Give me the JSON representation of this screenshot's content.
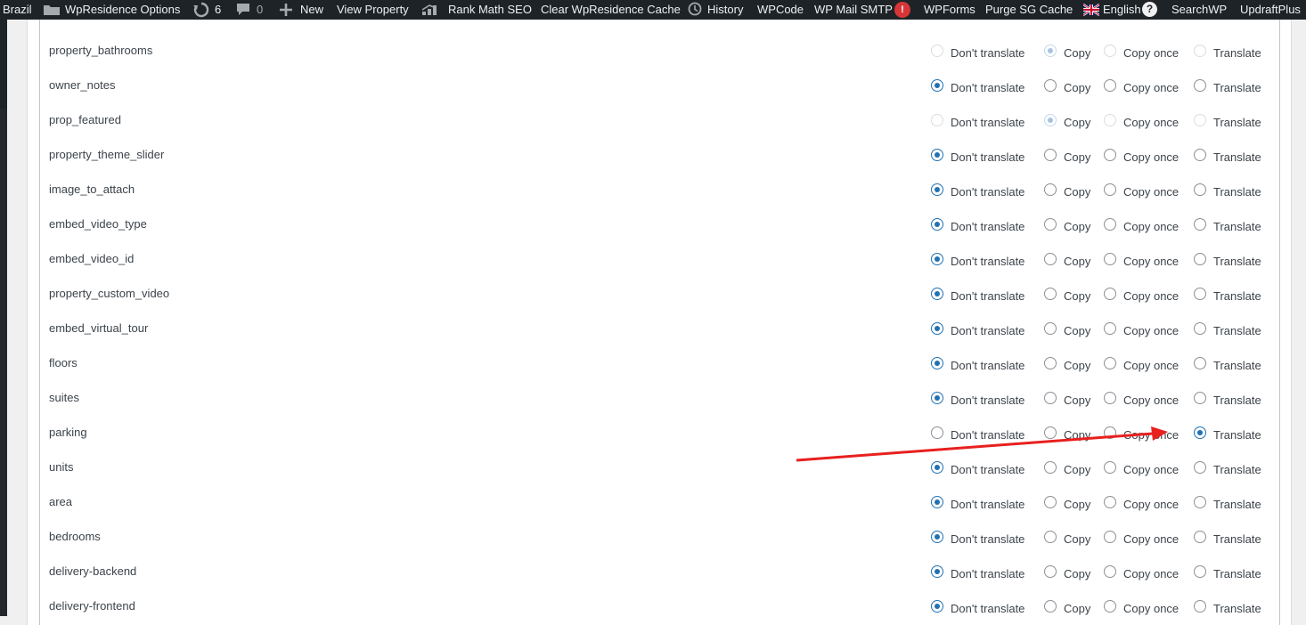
{
  "adminbar": {
    "site_name": "Brazil",
    "theme_options": "WpResidence Options",
    "updates_count": "6",
    "comments_count": "0",
    "new_label": "New",
    "view_property": "View Property",
    "rank_math": "Rank Math SEO",
    "clear_cache": "Clear WpResidence Cache",
    "history": "History",
    "wpcode": "WPCode",
    "wp_mail_smtp": "WP Mail SMTP",
    "smtp_alert": "!",
    "wpforms": "WPForms",
    "purge_cache": "Purge SG Cache",
    "language": "English",
    "help": "?",
    "searchwp": "SearchWP",
    "updraftplus": "UpdraftPlus"
  },
  "options": [
    "Don't translate",
    "Copy",
    "Copy once",
    "Translate"
  ],
  "fields": [
    {
      "name": "property_bathrooms",
      "selected": 1,
      "disabled": true
    },
    {
      "name": "owner_notes",
      "selected": 0,
      "disabled": false
    },
    {
      "name": "prop_featured",
      "selected": 1,
      "disabled": true
    },
    {
      "name": "property_theme_slider",
      "selected": 0,
      "disabled": false
    },
    {
      "name": "image_to_attach",
      "selected": 0,
      "disabled": false
    },
    {
      "name": "embed_video_type",
      "selected": 0,
      "disabled": false
    },
    {
      "name": "embed_video_id",
      "selected": 0,
      "disabled": false
    },
    {
      "name": "property_custom_video",
      "selected": 0,
      "disabled": false
    },
    {
      "name": "embed_virtual_tour",
      "selected": 0,
      "disabled": false
    },
    {
      "name": "floors",
      "selected": 0,
      "disabled": false
    },
    {
      "name": "suites",
      "selected": 0,
      "disabled": false
    },
    {
      "name": "parking",
      "selected": 3,
      "disabled": false
    },
    {
      "name": "units",
      "selected": 0,
      "disabled": false
    },
    {
      "name": "area",
      "selected": 0,
      "disabled": false
    },
    {
      "name": "bedrooms",
      "selected": 0,
      "disabled": false
    },
    {
      "name": "delivery-backend",
      "selected": 0,
      "disabled": false
    },
    {
      "name": "delivery-frontend",
      "selected": 0,
      "disabled": false
    }
  ],
  "colors": {
    "adminbar_bg": "#1d2327",
    "accent": "#2271b1",
    "annotation_arrow": "#e8201e",
    "alert_badge": "#d63638"
  }
}
